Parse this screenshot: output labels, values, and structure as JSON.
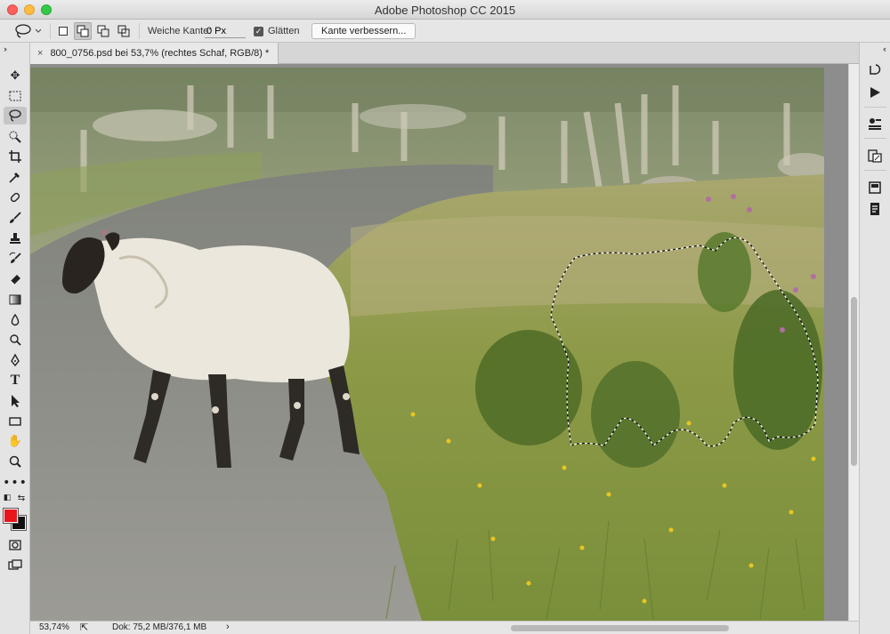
{
  "window": {
    "title": "Adobe Photoshop CC 2015"
  },
  "options_bar": {
    "feather_label": "Weiche Kante:",
    "feather_value": "0 Px",
    "antialias_label": "Glätten",
    "antialias_checked": true,
    "refine_edge_label": "Kante verbessern..."
  },
  "document_tab": {
    "label": "800_0756.psd bei 53,7% (rechtes Schaf, RGB/8) *",
    "close_glyph": "×"
  },
  "tools": [
    "move-tool",
    "marquee-tool",
    "lasso-tool",
    "quick-selection-tool",
    "crop-tool",
    "eyedropper-tool",
    "healing-brush-tool",
    "brush-tool",
    "clone-stamp-tool",
    "history-brush-tool",
    "eraser-tool",
    "gradient-tool",
    "blur-tool",
    "dodge-tool",
    "pen-tool",
    "type-tool",
    "path-selection-tool",
    "rectangle-tool",
    "hand-tool",
    "zoom-tool",
    "more-tools"
  ],
  "active_tool": "lasso-tool",
  "colors": {
    "foreground": "#e8161b",
    "background": "#111111"
  },
  "status_bar": {
    "zoom": "53,74%",
    "doc_info": "Dok: 75,2 MB/376,1 MB",
    "arrow": "›"
  },
  "right_panels": [
    "history-panel",
    "actions-panel",
    "properties-panel",
    "adjustments-panel",
    "layers-panel",
    "notes-panel"
  ]
}
